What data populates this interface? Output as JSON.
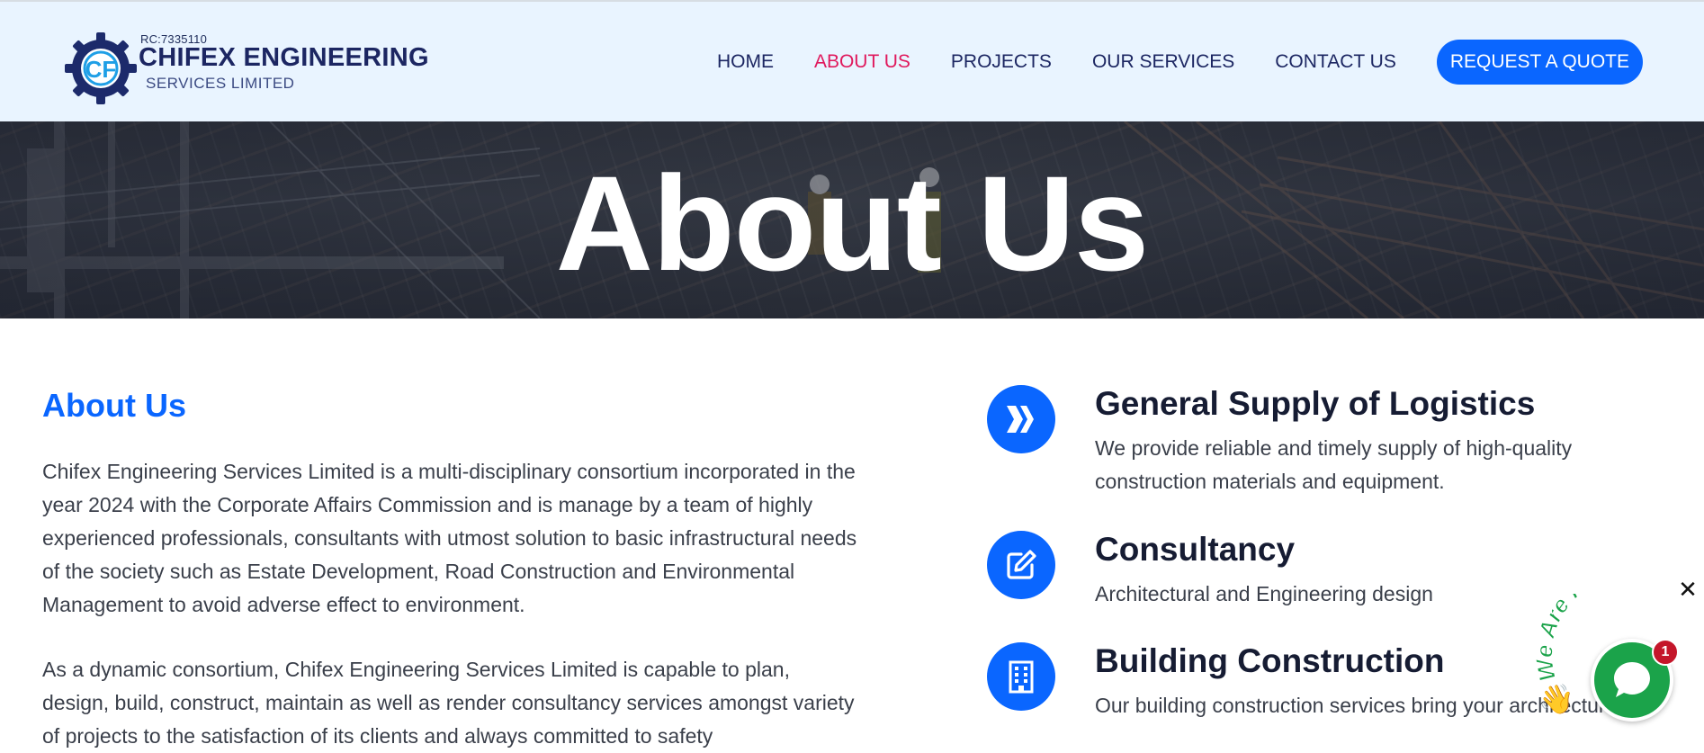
{
  "header": {
    "logo": {
      "rc_number": "RC:7335110",
      "name": "CHIFEX ENGINEERING",
      "subtitle": "SERVICES LIMITED",
      "monogram": "CF"
    },
    "nav": [
      {
        "label": "HOME",
        "active": false
      },
      {
        "label": "ABOUT US",
        "active": true
      },
      {
        "label": "PROJECTS",
        "active": false
      },
      {
        "label": "OUR SERVICES",
        "active": false
      },
      {
        "label": "CONTACT US",
        "active": false
      }
    ],
    "cta_label": "REQUEST A QUOTE"
  },
  "hero": {
    "title": "About Us"
  },
  "about": {
    "heading": "About Us",
    "paragraphs": [
      "Chifex Engineering Services Limited is a multi-disciplinary consortium incorporated in the year 2024 with the Corporate Affairs Commission and is manage by a team of highly experienced professionals, consultants with utmost solution to basic infrastructural needs of the society such as Estate Development, Road Construction and Environmental Management to avoid adverse effect to environment.",
      "As a dynamic consortium, Chifex Engineering Services Limited is capable to plan, design, build, construct, maintain as well as render consultancy services amongst variety of projects to the satisfaction of its clients and always committed to safety"
    ]
  },
  "services": [
    {
      "icon": "chevrons-right-icon",
      "title": "General Supply of Logistics",
      "description": "We provide reliable and timely supply of high-quality construction materials and equipment."
    },
    {
      "icon": "edit-icon",
      "title": "Consultancy",
      "description": "Architectural and Engineering design"
    },
    {
      "icon": "building-icon",
      "title": "Building Construction",
      "description": "Our building construction services bring your architectural"
    }
  ],
  "chat_widget": {
    "banner_text": "We Are Here!",
    "badge_count": "1",
    "close_symbol": "✕",
    "wave_emoji": "👋"
  },
  "colors": {
    "header_bg": "#e9f4ff",
    "brand_navy": "#1c2662",
    "accent_blue": "#0a66ff",
    "active_pink": "#e0195d",
    "chat_green": "#1ba34a",
    "badge_red": "#c4162a"
  }
}
